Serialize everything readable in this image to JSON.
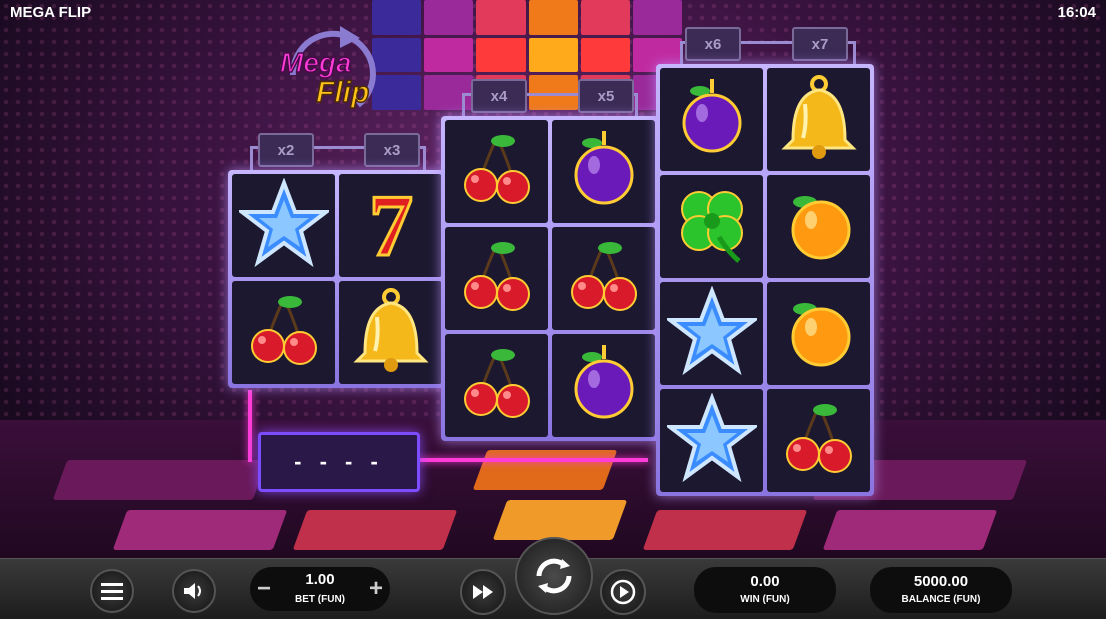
{
  "header": {
    "title": "MEGA FLIP",
    "clock": "16:04"
  },
  "logo": {
    "line1": "Mega",
    "line2": "Flip"
  },
  "multipliers": [
    "x2",
    "x3",
    "x4",
    "x5",
    "x6",
    "x7"
  ],
  "reels": {
    "group1": [
      [
        "blue-star",
        "red-seven"
      ],
      [
        "cherries",
        "gold-bell"
      ]
    ],
    "group2": [
      [
        "cherries",
        "purple-plum"
      ],
      [
        "cherries",
        "cherries"
      ],
      [
        "cherries",
        "purple-plum"
      ]
    ],
    "group3": [
      [
        "purple-plum",
        "gold-bell"
      ],
      [
        "green-clover",
        "orange"
      ],
      [
        "blue-star",
        "orange"
      ],
      [
        "blue-star",
        "cherries"
      ]
    ]
  },
  "dash_display": "- - - -",
  "controls": {
    "bet_value": "1.00",
    "bet_label": "BET (FUN)",
    "minus": "−",
    "plus": "+",
    "win_value": "0.00",
    "win_label": "WIN (FUN)",
    "balance_value": "5000.00",
    "balance_label": "BALANCE (FUN)"
  },
  "colors": {
    "neon": "#ff3cd8",
    "frame": "#9b8bd0",
    "bar": "#1d1d1d"
  }
}
